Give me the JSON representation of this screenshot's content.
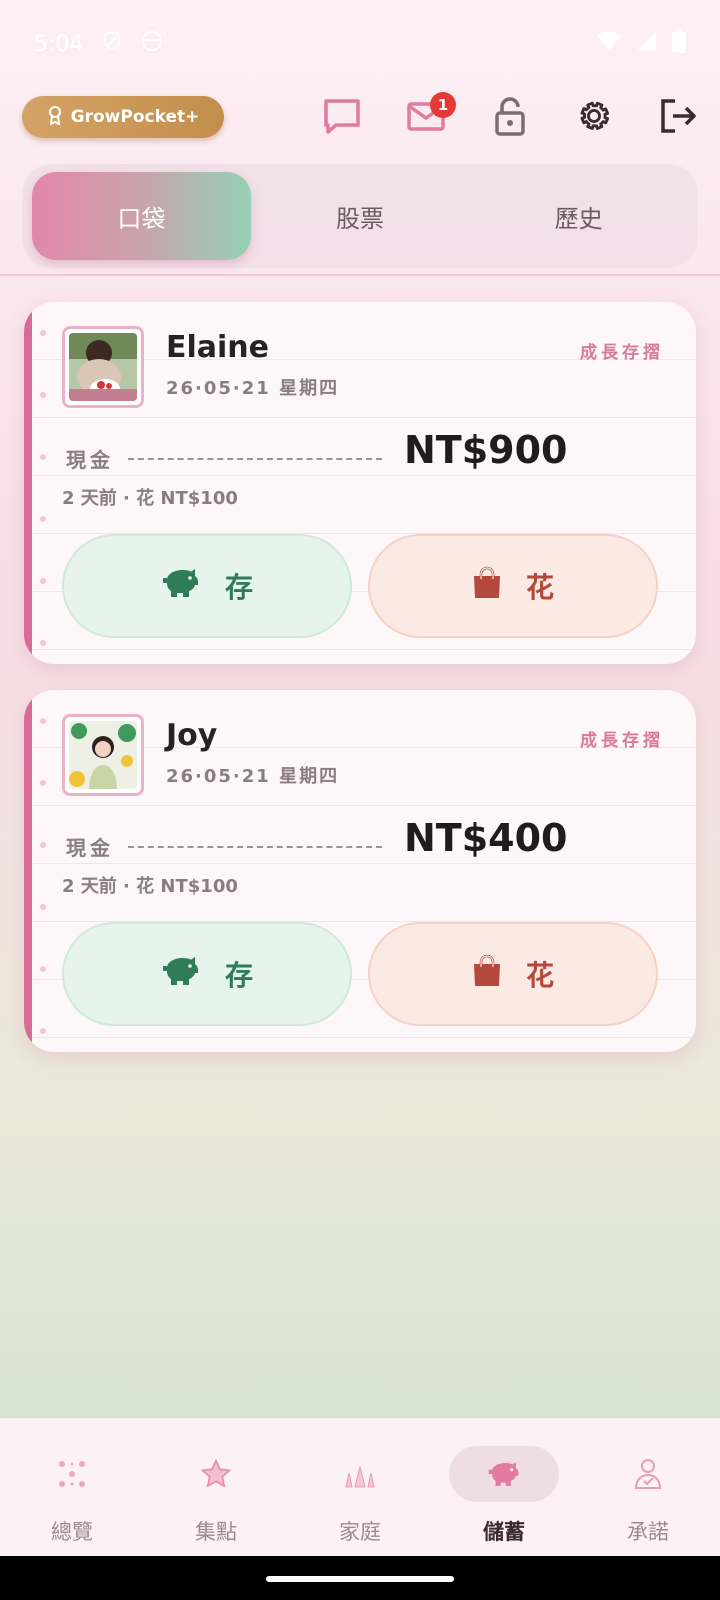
{
  "status_bar": {
    "time": "5:04"
  },
  "header": {
    "premium_label": "GrowPocket+",
    "mail_badge_count": "1"
  },
  "tabs": [
    {
      "label": "口袋",
      "active": true
    },
    {
      "label": "股票",
      "active": false
    },
    {
      "label": "歷史",
      "active": false
    }
  ],
  "cards": [
    {
      "name": "Elaine",
      "date": "26·05·21  星期四",
      "tag": "成長存摺",
      "cash_label": "現金",
      "amount": "NT$900",
      "recent": "2 天前 · 花 NT$100",
      "save_label": "存",
      "spend_label": "花"
    },
    {
      "name": "Joy",
      "date": "26·05·21  星期四",
      "tag": "成長存摺",
      "cash_label": "現金",
      "amount": "NT$400",
      "recent": "2 天前 · 花 NT$100",
      "save_label": "存",
      "spend_label": "花"
    }
  ],
  "bottom_nav": [
    {
      "label": "總覽",
      "icon": "dots-grid-icon",
      "active": false
    },
    {
      "label": "集點",
      "icon": "star-icon",
      "active": false
    },
    {
      "label": "家庭",
      "icon": "family-icon",
      "active": false
    },
    {
      "label": "儲蓄",
      "icon": "piggy-bank-icon",
      "active": true
    },
    {
      "label": "承諾",
      "icon": "promise-icon",
      "active": false
    }
  ],
  "colors": {
    "accent_pink": "#d86a98",
    "save_green": "#2f7d58",
    "spend_red": "#b5483d",
    "premium_gold": "#c99a5a"
  }
}
